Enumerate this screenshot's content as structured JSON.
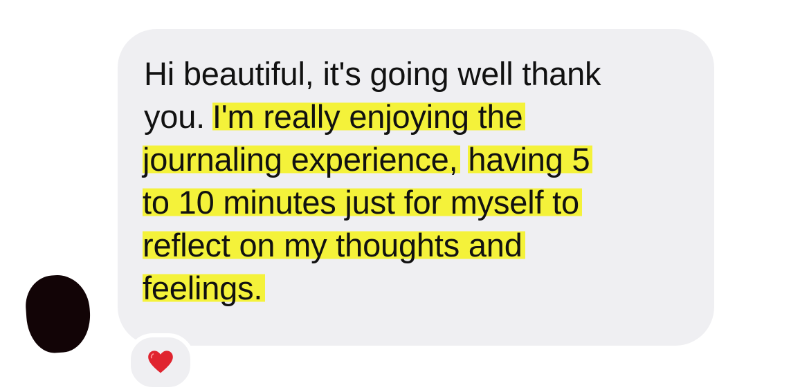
{
  "message": {
    "lines": [
      {
        "plain": "Hi beautiful, it's going well thank",
        "highlight": ""
      },
      {
        "plain": "you. ",
        "highlight": "I'm really enjoying the"
      },
      {
        "plain": "",
        "highlight": "journaling experience,",
        "plain2": " ",
        "highlight2": "having 5"
      },
      {
        "plain": "",
        "highlight": "to 10 minutes just for myself to"
      },
      {
        "plain": "",
        "highlight": "reflect on my thoughts and"
      },
      {
        "plain": "",
        "highlight": "feelings."
      }
    ]
  },
  "reaction": {
    "icon": "red-heart-icon",
    "color": "#e0242f"
  },
  "colors": {
    "bubble_background": "#efeff2",
    "highlight": "#f4f23a",
    "avatar": "#120406"
  }
}
